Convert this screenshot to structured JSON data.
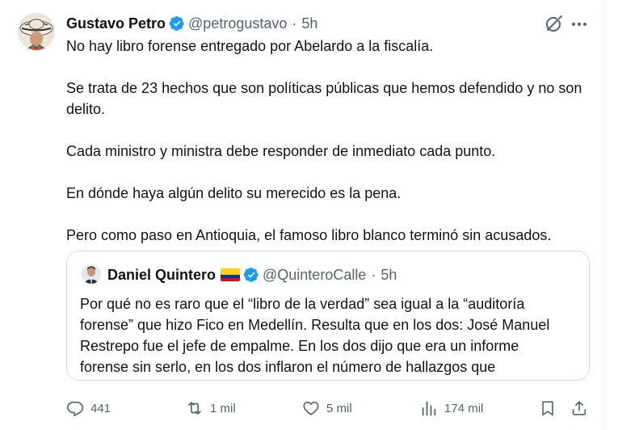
{
  "tweet": {
    "author_name": "Gustavo Petro",
    "handle": "@petrogustavo",
    "separator": "·",
    "time": "5h",
    "paragraphs": [
      "No hay libro forense entregado por Abelardo a la fiscalía.",
      "Se trata de 23 hechos que son políticas públicas que hemos defendido y no son delito.",
      "Cada ministro y ministra debe responder de inmediato cada punto.",
      "En dónde haya algún delito su merecido es la pena.",
      "Pero como paso en Antioquia, el famoso libro blanco terminó sin acusados."
    ]
  },
  "quoted": {
    "author_name": "Daniel Quintero",
    "handle": "@QuinteroCalle",
    "separator": "·",
    "time": "5h",
    "lines": [
      "Por qué no es raro que el “libro de la verdad” sea igual a la “auditoría",
      "forense” que hizo Fico en Medellín. Resulta que en los dos: José Manuel",
      "Restrepo fue el jefe de empalme. En los dos dijo que era un informe",
      "forense sin serlo, en los dos inflaron el número de hallazgos que"
    ]
  },
  "actions": {
    "replies": "441",
    "reposts": "1 mil",
    "likes": "5 mil",
    "views": "174 mil"
  },
  "icons": {
    "verified": "verified-badge-icon",
    "grok": "grok-icon",
    "more": "more-icon",
    "reply": "reply-icon",
    "repost": "repost-icon",
    "like": "heart-icon",
    "views": "views-icon",
    "bookmark": "bookmark-icon",
    "share": "share-icon"
  },
  "colors": {
    "verified": "#1d9bf0",
    "text_primary": "#0f1419",
    "text_secondary": "#536471",
    "border": "#cfd9de",
    "flag_yellow": "#fcd116",
    "flag_blue": "#003893",
    "flag_red": "#ce1126"
  }
}
